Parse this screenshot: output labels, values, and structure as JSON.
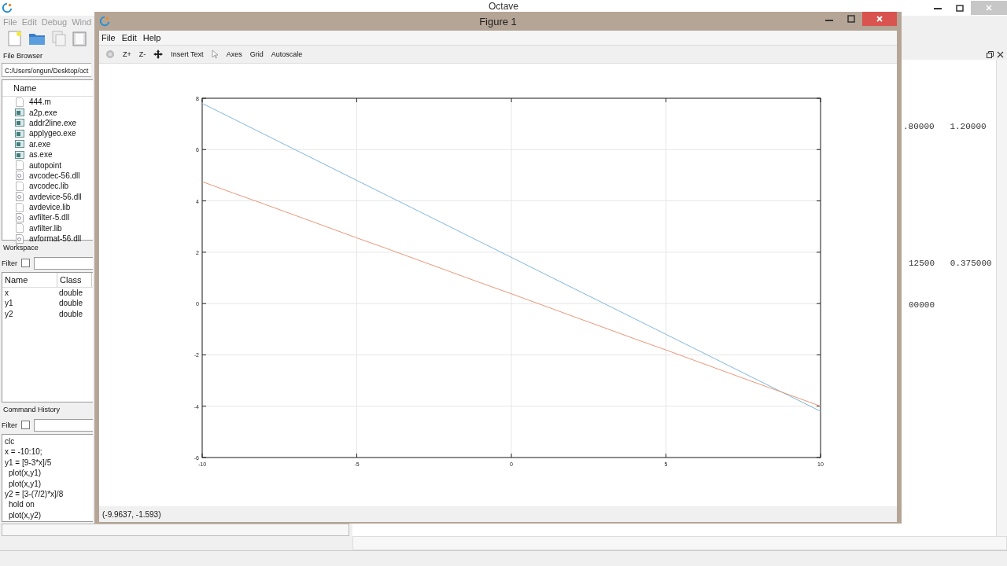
{
  "main_window": {
    "title": "Octave",
    "menu": [
      "File",
      "Edit",
      "Debug",
      "Wind"
    ]
  },
  "file_browser": {
    "title": "File Browser",
    "path": "C:/Users/ongun/Desktop/oct",
    "column": "Name",
    "files": [
      {
        "name": "444.m",
        "kind": "file"
      },
      {
        "name": "a2p.exe",
        "kind": "exe"
      },
      {
        "name": "addr2line.exe",
        "kind": "exe"
      },
      {
        "name": "applygeo.exe",
        "kind": "exe"
      },
      {
        "name": "ar.exe",
        "kind": "exe"
      },
      {
        "name": "as.exe",
        "kind": "exe"
      },
      {
        "name": "autopoint",
        "kind": "file"
      },
      {
        "name": "avcodec-56.dll",
        "kind": "dll"
      },
      {
        "name": "avcodec.lib",
        "kind": "file"
      },
      {
        "name": "avdevice-56.dll",
        "kind": "dll"
      },
      {
        "name": "avdevice.lib",
        "kind": "file"
      },
      {
        "name": "avfilter-5.dll",
        "kind": "dll"
      },
      {
        "name": "avfilter.lib",
        "kind": "file"
      },
      {
        "name": "avformat-56.dll",
        "kind": "dll"
      }
    ]
  },
  "workspace": {
    "title": "Workspace",
    "filter_label": "Filter",
    "filter_checked": false,
    "columns": [
      "Name",
      "Class"
    ],
    "rows": [
      {
        "name": "x",
        "class": "double"
      },
      {
        "name": "y1",
        "class": "double"
      },
      {
        "name": "y2",
        "class": "double"
      }
    ]
  },
  "command_history": {
    "title": "Command History",
    "filter_label": "Filter",
    "filter_checked": false,
    "commands": [
      {
        "text": "clc",
        "indented": false
      },
      {
        "text": "x = -10:10;",
        "indented": false
      },
      {
        "text": "y1 = [9-3*x]/5",
        "indented": false
      },
      {
        "text": "plot(x,y1)",
        "indented": true
      },
      {
        "text": "plot(x,y1)",
        "indented": true
      },
      {
        "text": "y2 = [3-(7/2)*x]/8",
        "indented": false
      },
      {
        "text": "hold on",
        "indented": true
      },
      {
        "text": "plot(x,y2)",
        "indented": true
      }
    ]
  },
  "console": {
    "lines": [
      ".80000   1.20000",
      "12500   0.375000",
      "00000"
    ]
  },
  "figure": {
    "title": "Figure 1",
    "menu": [
      "File",
      "Edit",
      "Help"
    ],
    "toolbar": [
      "Z+",
      "Z-",
      "Insert Text",
      "Axes",
      "Grid",
      "Autoscale"
    ],
    "status": "(-9.9637, -1.593)",
    "chart_data": {
      "type": "line",
      "x": [
        -10,
        -9,
        -8,
        -7,
        -6,
        -5,
        -4,
        -3,
        -2,
        -1,
        0,
        1,
        2,
        3,
        4,
        5,
        6,
        7,
        8,
        9,
        10
      ],
      "series": [
        {
          "color": "#7fb6dc",
          "values": [
            7.8,
            7.2,
            6.6,
            6,
            5.4,
            4.8,
            4.2,
            3.6,
            3,
            2.4,
            1.8,
            1.2,
            0.6,
            0,
            -0.6,
            -1.2,
            -1.8,
            -2.4,
            -3,
            -3.6,
            -4.2
          ]
        },
        {
          "color": "#e8977a",
          "values": [
            4.75,
            4.31,
            3.88,
            3.44,
            3,
            2.56,
            2.13,
            1.69,
            1.25,
            0.81,
            0.38,
            -0.06,
            -0.5,
            -0.94,
            -1.38,
            -1.81,
            -2.25,
            -2.69,
            -3.13,
            -3.56,
            -4
          ]
        }
      ],
      "grid": true,
      "xlim": [
        -10,
        10
      ],
      "ylim": [
        -6,
        8
      ],
      "xticks": [
        -10,
        -5,
        0,
        5,
        10
      ],
      "yticks": [
        -6,
        -4,
        -2,
        0,
        2,
        4,
        6,
        8
      ]
    }
  }
}
